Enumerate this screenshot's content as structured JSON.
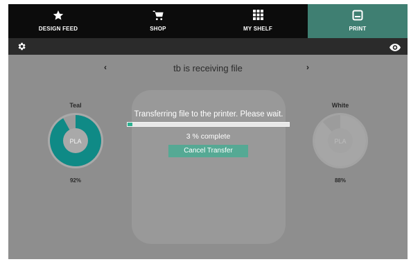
{
  "nav": {
    "tabs": [
      {
        "label": "DESIGN FEED",
        "icon": "star-icon"
      },
      {
        "label": "SHOP",
        "icon": "cart-icon"
      },
      {
        "label": "MY SHELF",
        "icon": "grid-icon"
      },
      {
        "label": "PRINT",
        "icon": "printer-icon"
      }
    ],
    "active_index": 3
  },
  "header": {
    "title": "tb is receiving file",
    "prev": "‹",
    "next": "›"
  },
  "spools": [
    {
      "name": "Teal",
      "material": "PLA",
      "percent": "92%",
      "fill_fraction": 0.92,
      "color": "#0f8a86"
    },
    {
      "name": "White",
      "material": "PLA",
      "percent": "88%",
      "fill_fraction": 0.88,
      "color": "#a6a6a6"
    }
  ],
  "transfer": {
    "message": "Transferring file to the printer. Please wait.",
    "progress_text": "3 % complete",
    "progress": 0.03,
    "cancel_label": "Cancel Transfer"
  },
  "colors": {
    "accent": "#3f7f72",
    "button": "#55a994",
    "progress": "#2bb08f"
  }
}
